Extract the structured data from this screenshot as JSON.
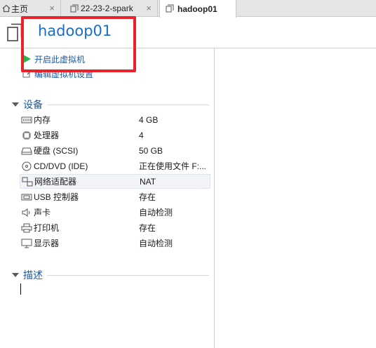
{
  "tabs": [
    {
      "label": "主页",
      "icon": "home-icon"
    },
    {
      "label": "22-23-2-spark",
      "icon": "vm-icon"
    },
    {
      "label": "hadoop01",
      "icon": "vm-icon",
      "active": true
    }
  ],
  "vm": {
    "title": "hadoop01"
  },
  "actions": {
    "power_on": "开启此虚拟机",
    "edit_settings": "编辑虚拟机设置"
  },
  "devices_section": {
    "title": "设备"
  },
  "devices": [
    {
      "name": "内存",
      "value": "4 GB",
      "icon": "memory-icon"
    },
    {
      "name": "处理器",
      "value": "4",
      "icon": "processor-icon"
    },
    {
      "name": "硬盘 (SCSI)",
      "value": "50 GB",
      "icon": "hard-disk-icon"
    },
    {
      "name": "CD/DVD (IDE)",
      "value": "正在使用文件 F:...",
      "icon": "cd-dvd-icon"
    },
    {
      "name": "网络适配器",
      "value": "NAT",
      "icon": "network-adapter-icon"
    },
    {
      "name": "USB 控制器",
      "value": "存在",
      "icon": "usb-icon"
    },
    {
      "name": "声卡",
      "value": "自动检测",
      "icon": "sound-card-icon"
    },
    {
      "name": "打印机",
      "value": "存在",
      "icon": "printer-icon"
    },
    {
      "name": "显示器",
      "value": "自动检测",
      "icon": "display-icon"
    }
  ],
  "description_section": {
    "title": "描述"
  },
  "colors": {
    "accent": "#1a6fc2",
    "highlight": "#e8232a",
    "play": "#2db34a"
  }
}
